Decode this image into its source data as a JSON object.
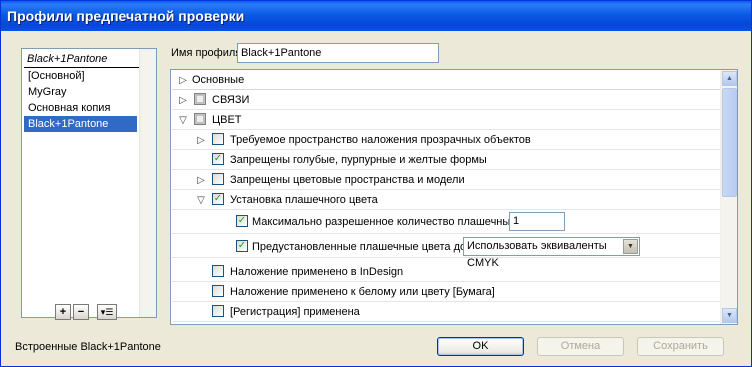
{
  "window": {
    "title": "Профили предпечатной проверки"
  },
  "profiles": {
    "header": "Black+1Pantone",
    "items": [
      "[Основной]",
      "MyGray",
      "Основная копия",
      "Black+1Pantone"
    ],
    "selected": "Black+1Pantone"
  },
  "list_buttons": {
    "add": "+",
    "remove": "−",
    "menu": "▾☰"
  },
  "embedded_label": "Встроенные Black+1Pantone",
  "profile_name": {
    "label": "Имя профиля:",
    "value": "Black+1Pantone"
  },
  "tree": {
    "basic": "Основные",
    "links": "СВЯЗИ",
    "color": "ЦВЕТ",
    "transparency_space": "Требуемое пространство наложения прозрачных объектов",
    "cmy_forbidden": "Запрещены голубые, пурпурные и желтые формы",
    "color_spaces_forbidden": "Запрещены цветовые пространства и модели",
    "spot_setup": "Установка плашечного цвета",
    "max_spot_label": "Максимально разрешенное количество плашечных цветов:",
    "max_spot_value": "1",
    "preset_spot_label": "Предустановленные плашечные цвета должны:",
    "preset_spot_value": "Использовать эквиваленты CMYK",
    "overprint_indesign": "Наложение применено в InDesign",
    "overprint_white": "Наложение применено к белому или цвету [Бумага]",
    "registration": "[Регистрация] применена"
  },
  "buttons": {
    "ok": "OK",
    "cancel": "Отмена",
    "save": "Сохранить"
  },
  "colors": {
    "title_bar": "#0a5ae6",
    "selection": "#316ac5",
    "dialog_bg": "#ece9d8"
  }
}
